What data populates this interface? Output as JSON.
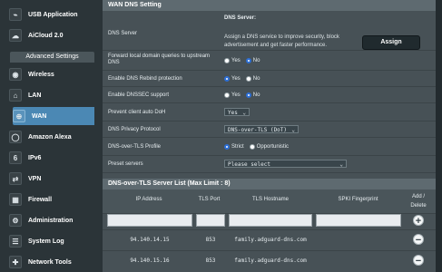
{
  "sidebar": {
    "items": [
      {
        "label": "USB Application",
        "icon": "usb-icon",
        "glyph": "⌁"
      },
      {
        "label": "AiCloud 2.0",
        "icon": "cloud-icon",
        "glyph": "☁"
      }
    ],
    "advanced_header": "Advanced Settings",
    "advanced_items": [
      {
        "label": "Wireless",
        "icon": "wifi-icon",
        "glyph": "◉"
      },
      {
        "label": "LAN",
        "icon": "home-icon",
        "glyph": "⌂"
      },
      {
        "label": "WAN",
        "icon": "globe-icon",
        "glyph": "⊕"
      },
      {
        "label": "Amazon Alexa",
        "icon": "alexa-icon",
        "glyph": "◯"
      },
      {
        "label": "IPv6",
        "icon": "ipv6-icon",
        "glyph": "6"
      },
      {
        "label": "VPN",
        "icon": "vpn-icon",
        "glyph": "⇄"
      },
      {
        "label": "Firewall",
        "icon": "firewall-icon",
        "glyph": "▦"
      },
      {
        "label": "Administration",
        "icon": "user-admin-icon",
        "glyph": "⚙"
      },
      {
        "label": "System Log",
        "icon": "log-icon",
        "glyph": "☰"
      },
      {
        "label": "Network Tools",
        "icon": "tools-icon",
        "glyph": "✚"
      }
    ],
    "active": "WAN"
  },
  "panel": {
    "title": "WAN DNS Setting",
    "dns_server": {
      "label": "DNS Server",
      "heading": "DNS Server:",
      "description": "Assign a DNS service to improve security, block advertisement and get faster performance.",
      "button": "Assign"
    },
    "forward_local": {
      "label": "Forward local domain queries to upstream DNS",
      "yes": "Yes",
      "no": "No",
      "selected": "No"
    },
    "dns_rebind": {
      "label": "Enable DNS Rebind protection",
      "yes": "Yes",
      "no": "No",
      "selected": "Yes"
    },
    "dnssec": {
      "label": "Enable DNSSEC support",
      "yes": "Yes",
      "no": "No",
      "selected": "No"
    },
    "prevent_doh": {
      "label": "Prevent client auto DoH",
      "value": "Yes"
    },
    "privacy_protocol": {
      "label": "DNS Privacy Protocol",
      "value": "DNS-over-TLS (DoT)"
    },
    "dot_profile": {
      "label": "DNS-over-TLS Profile",
      "strict": "Strict",
      "opportunistic": "Opportunistic",
      "selected": "Strict"
    },
    "preset_servers": {
      "label": "Preset servers",
      "value": "Please select"
    }
  },
  "server_list": {
    "title": "DNS-over-TLS Server List (Max Limit : 8)",
    "columns": [
      "IP Address",
      "TLS Port",
      "TLS Hostname",
      "SPKI Fingerprint",
      "Add / Delete"
    ],
    "rows": [
      {
        "ip": "94.140.14.15",
        "port": "853",
        "hostname": "family.adguard-dns.com",
        "spki": ""
      },
      {
        "ip": "94.140.15.16",
        "port": "853",
        "hostname": "family.adguard-dns.com",
        "spki": ""
      }
    ]
  },
  "colors": {
    "active_nav": "#4b88b4",
    "panel_bg": "#475156",
    "radio_selected": "#2d6fd6"
  }
}
